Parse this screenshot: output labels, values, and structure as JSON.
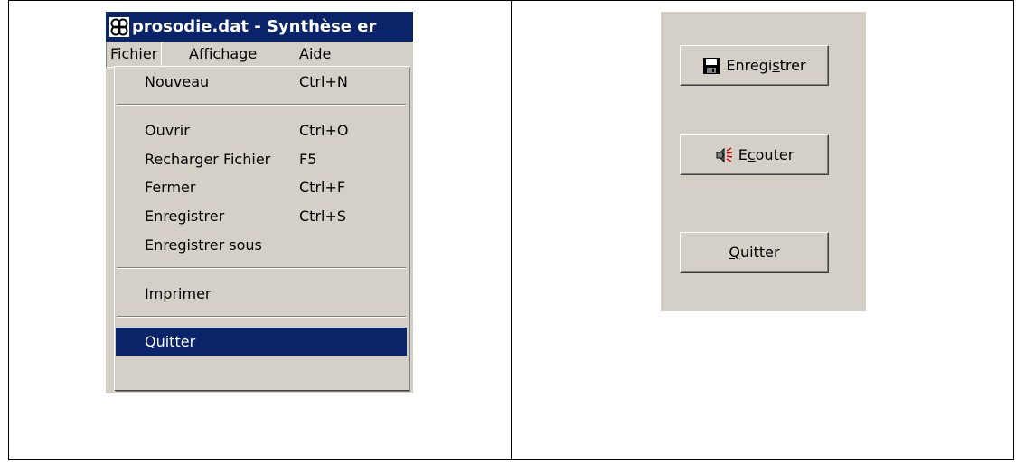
{
  "left_window": {
    "title": "prosodie.dat - Synthèse er",
    "menubar": [
      "Fichier",
      "Affichage",
      "Aide"
    ],
    "dropdown": [
      {
        "label": "Nouveau",
        "shortcut": "Ctrl+N"
      },
      {
        "label": "Ouvrir",
        "shortcut": "Ctrl+O"
      },
      {
        "label": "Recharger Fichier",
        "shortcut": "F5"
      },
      {
        "label": "Fermer",
        "shortcut": "Ctrl+F"
      },
      {
        "label": "Enregistrer",
        "shortcut": "Ctrl+S"
      },
      {
        "label": "Enregistrer sous",
        "shortcut": ""
      },
      {
        "label": "Imprimer",
        "shortcut": ""
      },
      {
        "label": "Quitter",
        "shortcut": ""
      }
    ],
    "selected_item": "Quitter",
    "icons": {
      "app": "app-logo-icon"
    }
  },
  "right_panel": {
    "buttons": [
      {
        "pre": "Enregi",
        "mnemonic": "s",
        "post": "trer",
        "icon": "floppy-disk-icon"
      },
      {
        "pre": "E",
        "mnemonic": "c",
        "post": "outer",
        "icon": "speaker-icon"
      },
      {
        "pre": "",
        "mnemonic": "Q",
        "post": "uitter",
        "icon": ""
      }
    ]
  },
  "colors": {
    "selection": "#0a246a",
    "face": "#d4d0c8"
  }
}
